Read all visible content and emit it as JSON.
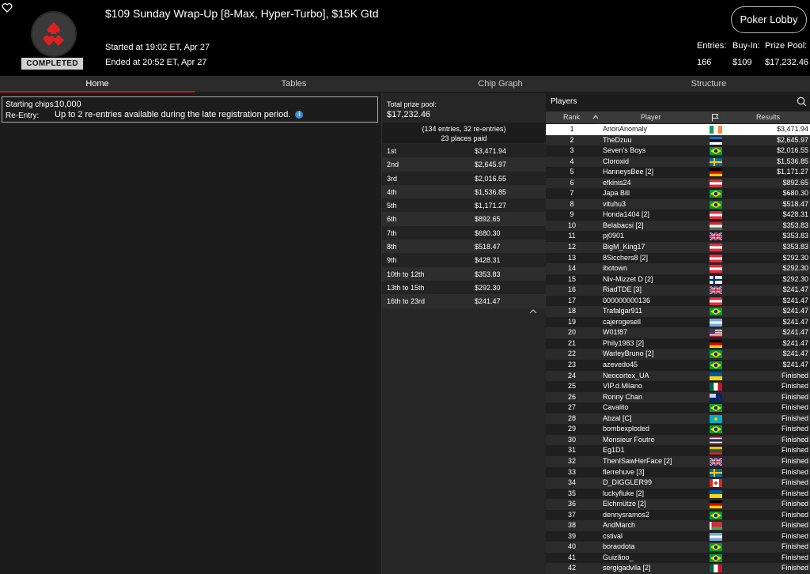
{
  "header": {
    "status": "COMPLETED",
    "title": "$109 Sunday Wrap-Up [8-Max, Hyper-Turbo], $15K Gtd",
    "started": "Started at 19:02 ET, Apr 27",
    "ended": "Ended at 20:52 ET, Apr 27",
    "lobby_button": "Poker Lobby",
    "entries_label": "Entries:",
    "entries_value": "166",
    "buyin_label": "Buy-In:",
    "buyin_value": "$109",
    "prizepool_label": "Prize Pool:",
    "prizepool_value": "$17,232.46"
  },
  "tabs": [
    "Home",
    "Tables",
    "Chip Graph",
    "Structure"
  ],
  "info": {
    "starting_chips_label": "Starting chips:",
    "starting_chips_value": "10,000",
    "reentry_label": "Re-Entry:",
    "reentry_value": "Up to 2 re-entries available during the late registration period."
  },
  "prize": {
    "title": "Total prize pool:",
    "total": "$17,232.46",
    "entries_line": "(134 entries, 32 re-entries)",
    "places_line": "23 places paid",
    "payouts": [
      {
        "place": "1st",
        "amount": "$3,471.94"
      },
      {
        "place": "2nd",
        "amount": "$2,645.97"
      },
      {
        "place": "3rd",
        "amount": "$2,016.55"
      },
      {
        "place": "4th",
        "amount": "$1,536.85"
      },
      {
        "place": "5th",
        "amount": "$1,171.27"
      },
      {
        "place": "6th",
        "amount": "$892.65"
      },
      {
        "place": "7th",
        "amount": "$680.30"
      },
      {
        "place": "8th",
        "amount": "$518.47"
      },
      {
        "place": "9th",
        "amount": "$428.31"
      },
      {
        "place": "10th to 12th",
        "amount": "$353.83"
      },
      {
        "place": "13th to 15th",
        "amount": "$292.30"
      },
      {
        "place": "16th to 23rd",
        "amount": "$241.47"
      }
    ]
  },
  "players": {
    "title": "Players",
    "col_rank": "Rank",
    "col_player": "Player",
    "col_results": "Results",
    "rows": [
      {
        "rank": "1",
        "name": "AnonAnomaly",
        "flag": "ie",
        "result": "$3,471.94"
      },
      {
        "rank": "2",
        "name": "TheDzuu",
        "flag": "ee",
        "result": "$2,645.97"
      },
      {
        "rank": "3",
        "name": "Seven's Boys",
        "flag": "br",
        "result": "$2,016.55"
      },
      {
        "rank": "4",
        "name": "Cloroxid",
        "flag": "se",
        "result": "$1,536.85"
      },
      {
        "rank": "5",
        "name": "HanneysBee [2]",
        "flag": "de",
        "result": "$1,171.27"
      },
      {
        "rank": "6",
        "name": "efkinis24",
        "flag": "at",
        "result": "$892.65"
      },
      {
        "rank": "7",
        "name": "Japa Bill",
        "flag": "br",
        "result": "$680.30"
      },
      {
        "rank": "8",
        "name": "vituhu3",
        "flag": "br",
        "result": "$518.47"
      },
      {
        "rank": "9",
        "name": "Honda1404 [2]",
        "flag": "at",
        "result": "$428.31"
      },
      {
        "rank": "10",
        "name": "Belabacsi [2]",
        "flag": "hu",
        "result": "$353.83"
      },
      {
        "rank": "11",
        "name": "pj0901",
        "flag": "gb",
        "result": "$353.83"
      },
      {
        "rank": "12",
        "name": "BigM_King17",
        "flag": "at",
        "result": "$353.83"
      },
      {
        "rank": "13",
        "name": "8Sicchers8 [2]",
        "flag": "at",
        "result": "$292.30"
      },
      {
        "rank": "14",
        "name": "ibotown",
        "flag": "at",
        "result": "$292.30"
      },
      {
        "rank": "15",
        "name": "Niv-Mizzet D [2]",
        "flag": "fi",
        "result": "$292.30"
      },
      {
        "rank": "16",
        "name": "RiadTDE [3]",
        "flag": "gb",
        "result": "$241.47"
      },
      {
        "rank": "17",
        "name": "000000000136",
        "flag": "at",
        "result": "$241.47"
      },
      {
        "rank": "18",
        "name": "Trafalgar911",
        "flag": "br",
        "result": "$241.47"
      },
      {
        "rank": "19",
        "name": "cajerogesell",
        "flag": "ar",
        "result": "$241.47"
      },
      {
        "rank": "20",
        "name": "W01f87",
        "flag": "us",
        "result": "$241.47"
      },
      {
        "rank": "21",
        "name": "Phily1983 [2]",
        "flag": "de",
        "result": "$241.47"
      },
      {
        "rank": "22",
        "name": "WarleyBruno [2]",
        "flag": "br",
        "result": "$241.47"
      },
      {
        "rank": "23",
        "name": "azevedo45",
        "flag": "br",
        "result": "$241.47"
      },
      {
        "rank": "24",
        "name": "Neocortex_UA",
        "flag": "ua",
        "result": "Finished"
      },
      {
        "rank": "25",
        "name": "VIP.d.Milano",
        "flag": "mx",
        "result": "Finished"
      },
      {
        "rank": "26",
        "name": "Ronny Chan",
        "flag": "nz",
        "result": "Finished"
      },
      {
        "rank": "27",
        "name": "Cavalito",
        "flag": "br",
        "result": "Finished"
      },
      {
        "rank": "28",
        "name": "Abzal [C]",
        "flag": "kz",
        "result": "Finished"
      },
      {
        "rank": "29",
        "name": "bombexploded",
        "flag": "br",
        "result": "Finished"
      },
      {
        "rank": "30",
        "name": "Monsieur Foutre",
        "flag": "th",
        "result": "Finished"
      },
      {
        "rank": "31",
        "name": "Eg1D1",
        "flag": "lt",
        "result": "Finished"
      },
      {
        "rank": "32",
        "name": "ThenISawHerFace [2]",
        "flag": "gb",
        "result": "Finished"
      },
      {
        "rank": "33",
        "name": "flerrehuve [3]",
        "flag": "se",
        "result": "Finished"
      },
      {
        "rank": "34",
        "name": "D_DIGGLER99",
        "flag": "ca",
        "result": "Finished"
      },
      {
        "rank": "35",
        "name": "luckyfluke [2]",
        "flag": "ua",
        "result": "Finished"
      },
      {
        "rank": "36",
        "name": "Elchmütze [2]",
        "flag": "de",
        "result": "Finished"
      },
      {
        "rank": "37",
        "name": "dennysramos2",
        "flag": "br",
        "result": "Finished"
      },
      {
        "rank": "38",
        "name": "AndMarch",
        "flag": "by",
        "result": "Finished"
      },
      {
        "rank": "39",
        "name": "cstival",
        "flag": "ar",
        "result": "Finished"
      },
      {
        "rank": "40",
        "name": "boraodota",
        "flag": "br",
        "result": "Finished"
      },
      {
        "rank": "41",
        "name": "Guizãoo_",
        "flag": "br",
        "result": "Finished"
      },
      {
        "rank": "42",
        "name": "sergigadvila [2]",
        "flag": "mx",
        "result": "Finished"
      }
    ]
  }
}
